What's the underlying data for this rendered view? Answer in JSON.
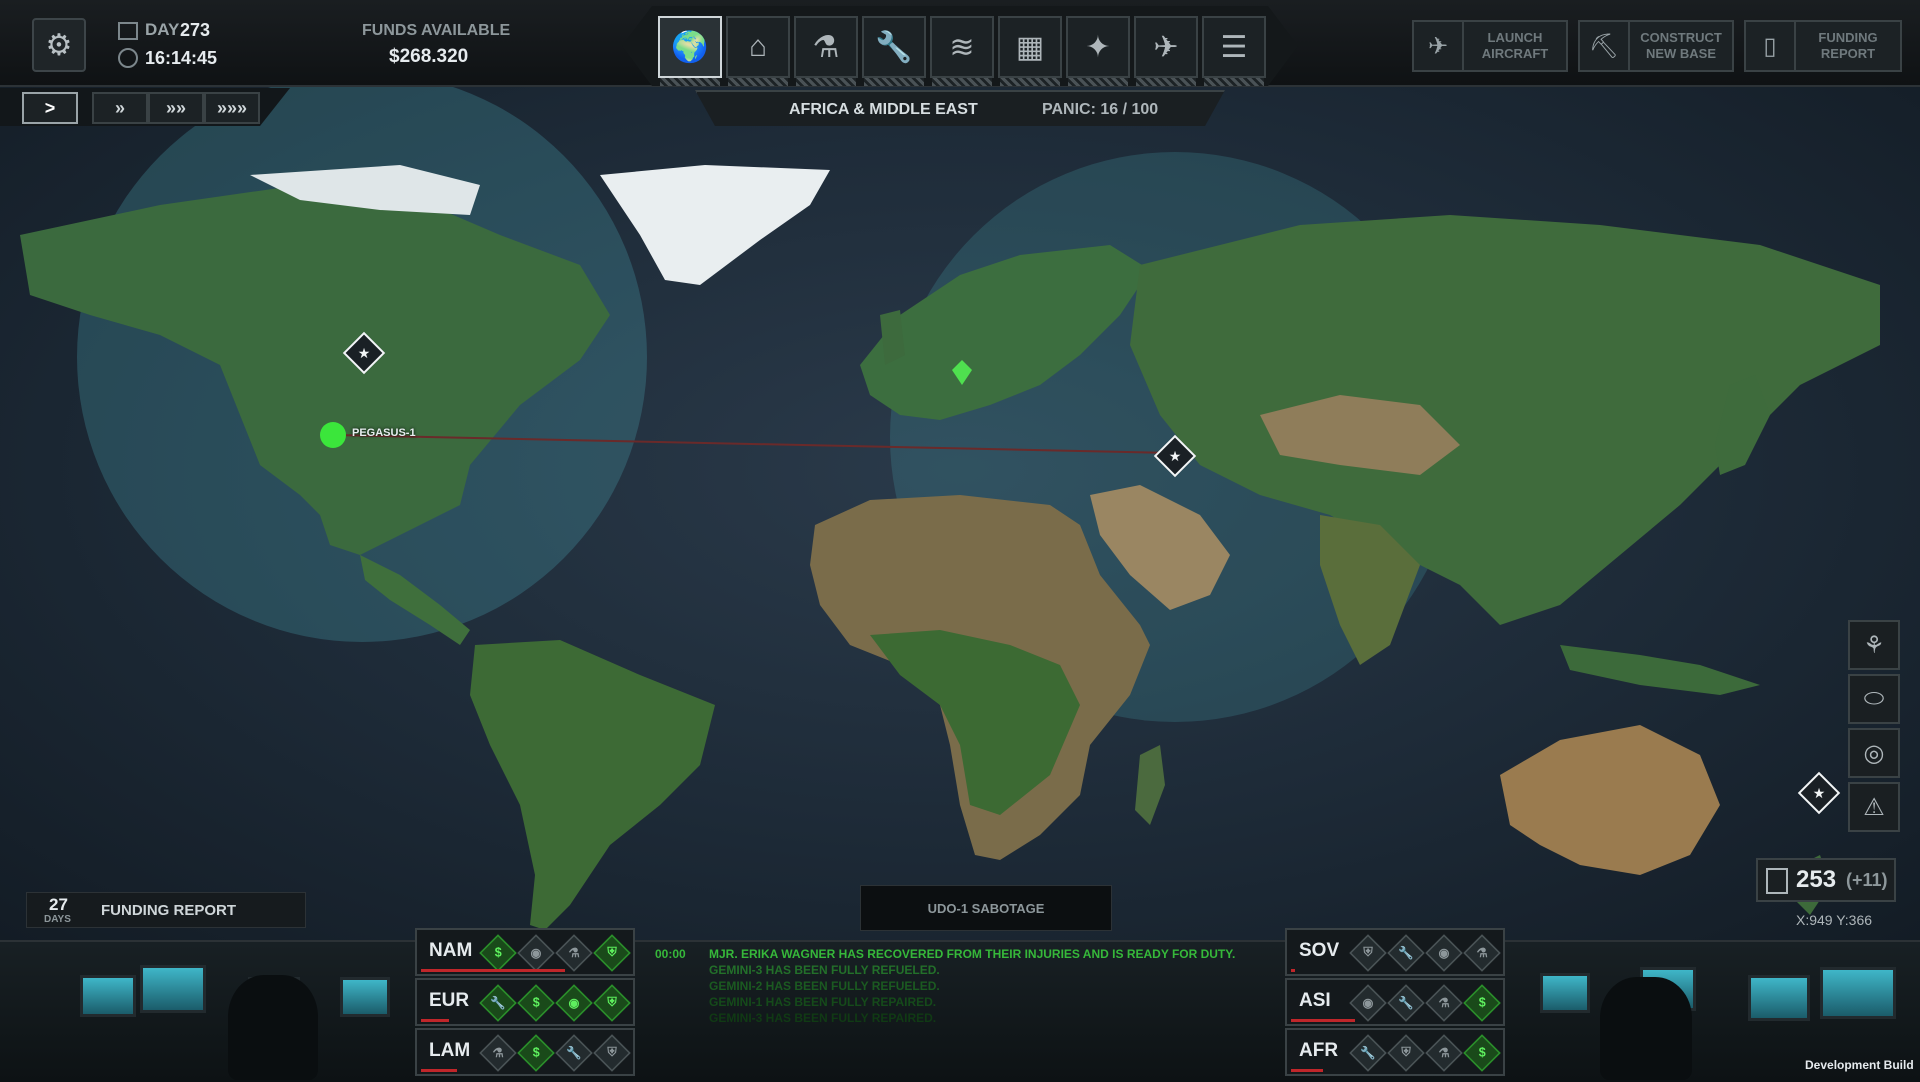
{
  "header": {
    "day_label": "DAY",
    "day_value": "273",
    "time": "16:14:45",
    "funds_label": "FUNDS AVAILABLE",
    "funds_value": "$268.320"
  },
  "nav_icons": [
    "globe-icon",
    "hangar-icon",
    "research-icon",
    "engineering-icon",
    "barracks-icon",
    "facilities-icon",
    "weapons-icon",
    "aircraft-icon",
    "archives-icon"
  ],
  "commands": {
    "launch_aircraft": "LAUNCH AIRCRAFT",
    "construct_base": "CONSTRUCT NEW BASE",
    "funding_report": "FUNDING REPORT"
  },
  "speed_controls": [
    ">",
    "»",
    "»»",
    "»»»"
  ],
  "region": {
    "name": "AFRICA & MIDDLE EAST",
    "panic": "PANIC: 16 / 100"
  },
  "map": {
    "craft_name": "PEGASUS-1",
    "radar_color": "#4aa7b3"
  },
  "side_panel": {
    "scientists": "253",
    "scientists_delta": "(+11)",
    "coords": "X:949  Y:366"
  },
  "funding_timer": {
    "value": "27",
    "unit": "DAYS",
    "label": "FUNDING REPORT"
  },
  "event": "UDO-1 SABOTAGE",
  "regions_left": [
    {
      "code": "NAM",
      "panic_fraction": 0.72
    },
    {
      "code": "EUR",
      "panic_fraction": 0.14
    },
    {
      "code": "LAM",
      "panic_fraction": 0.18
    }
  ],
  "regions_right": [
    {
      "code": "SOV",
      "panic_fraction": 0.02
    },
    {
      "code": "ASI",
      "panic_fraction": 0.32
    },
    {
      "code": "AFR",
      "panic_fraction": 0.16
    }
  ],
  "log": [
    {
      "time": "00:00",
      "text": "MJR. ERIKA WAGNER HAS RECOVERED FROM THEIR INJURIES AND IS READY FOR DUTY."
    },
    {
      "time": "",
      "text": "GEMINI-3 HAS BEEN FULLY REFUELED."
    },
    {
      "time": "",
      "text": "GEMINI-2 HAS BEEN FULLY REFUELED."
    },
    {
      "time": "",
      "text": "GEMINI-1 HAS BEEN FULLY REPAIRED."
    },
    {
      "time": "",
      "text": "GEMINI-3 HAS BEEN FULLY REPAIRED."
    }
  ],
  "footer": {
    "dev_build": "Development Build"
  }
}
